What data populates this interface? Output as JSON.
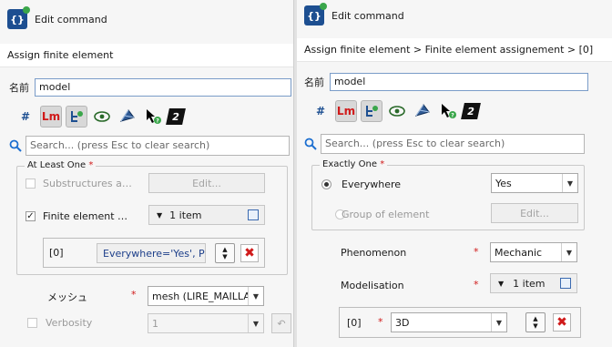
{
  "left": {
    "title": "Edit command",
    "command": "Assign finite element",
    "name_label": "名前",
    "name_value": "model",
    "search_placeholder": "Search... (press Esc to clear search)",
    "group_title": "At Least One",
    "group_required": "*",
    "option1_label": "Substructures a…",
    "option1_button": "Edit...",
    "option2_label": "Finite element …",
    "option2_button": "1 item",
    "item_index": "[0]",
    "item_value": "Everywhere='Yes', P…",
    "mesh_label": "メッシュ",
    "mesh_required": "*",
    "mesh_value": "mesh (LIRE_MAILLAGE",
    "verbosity_label": "Verbosity",
    "verbosity_value": "1"
  },
  "right": {
    "title": "Edit command",
    "breadcrumb": "Assign finite element > Finite element assignement > [0]",
    "name_label": "名前",
    "name_value": "model",
    "search_placeholder": "Search... (press Esc to clear search)",
    "group_title": "Exactly One",
    "group_required": "*",
    "everywhere_label": "Everywhere",
    "everywhere_value": "Yes",
    "group_of_element_label": "Group of element",
    "group_of_element_button": "Edit...",
    "phenomenon_label": "Phenomenon",
    "phenomenon_required": "*",
    "phenomenon_value": "Mechanic",
    "modelisation_label": "Modelisation",
    "modelisation_required": "*",
    "modelisation_button": "1 item",
    "item_index": "[0]",
    "item_required": "*",
    "item_value": "3D"
  },
  "icons": {
    "app": "{}",
    "hash": "#",
    "lm": "Lm",
    "hex": "2"
  },
  "colors": {
    "accent": "#1d4f91",
    "required": "#d01a1a",
    "focus": "#7a9cc8"
  }
}
